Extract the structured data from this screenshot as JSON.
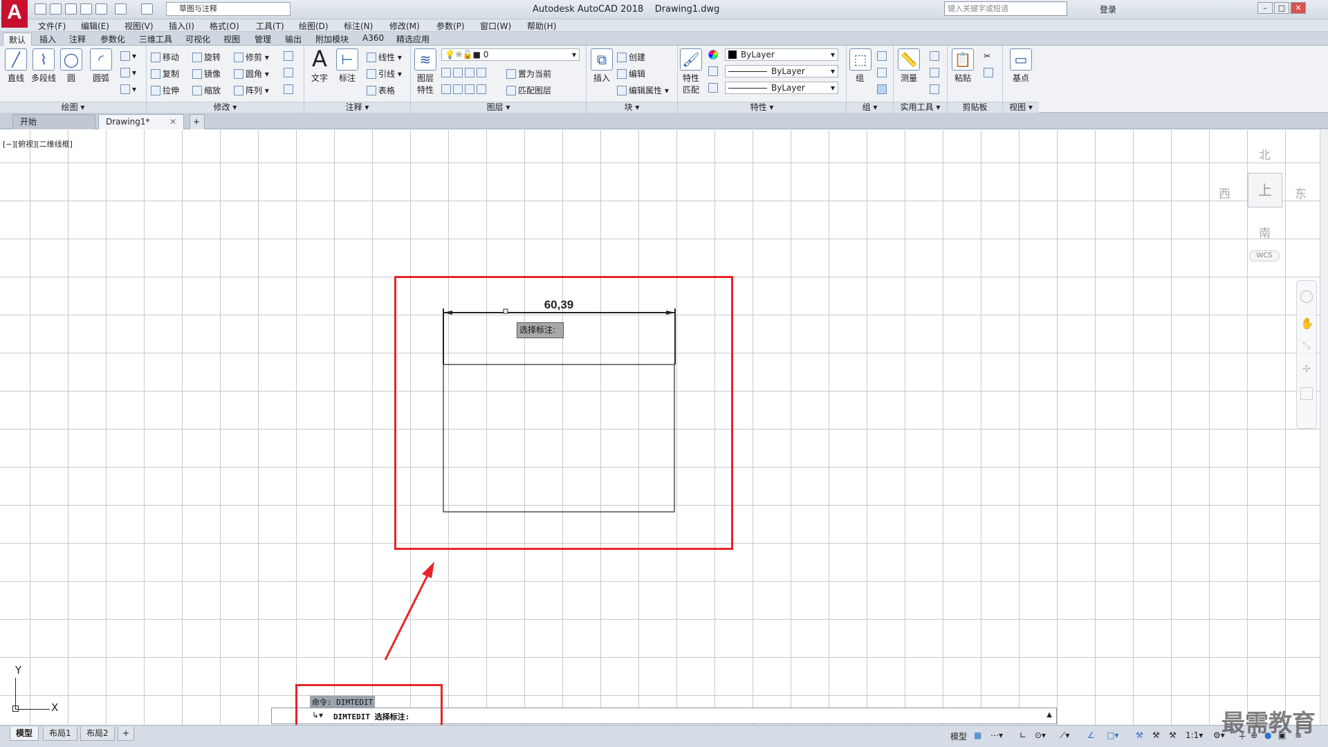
{
  "titlebar": {
    "workspace": "草图与注释",
    "title": "Autodesk AutoCAD 2018",
    "file": "Drawing1.dwg",
    "search_placeholder": "键入关键字或短语",
    "login": "登录"
  },
  "menu": [
    "文件(F)",
    "编辑(E)",
    "视图(V)",
    "插入(I)",
    "格式(O)",
    "工具(T)",
    "绘图(D)",
    "标注(N)",
    "修改(M)",
    "参数(P)",
    "窗口(W)",
    "帮助(H)"
  ],
  "ribbon_tabs": [
    "默认",
    "插入",
    "注释",
    "参数化",
    "三维工具",
    "可视化",
    "视图",
    "管理",
    "输出",
    "附加模块",
    "A360",
    "精选应用"
  ],
  "panels": {
    "draw": {
      "title": "绘图",
      "line": "直线",
      "polyline": "多段线",
      "circle": "圆",
      "arc": "圆弧"
    },
    "modify": {
      "title": "修改",
      "move": "移动",
      "rotate": "旋转",
      "trim": "修剪",
      "copy": "复制",
      "mirror": "镜像",
      "fillet": "圆角",
      "stretch": "拉伸",
      "scale": "缩放",
      "array": "阵列"
    },
    "annotation": {
      "title": "注释",
      "text": "文字",
      "dimension": "标注",
      "linear": "线性",
      "leader": "引线",
      "table": "表格"
    },
    "layers": {
      "title": "图层",
      "layer_props": "图层特性",
      "current_layer": "0",
      "set_current": "置为当前",
      "match": "匹配图层"
    },
    "block": {
      "title": "块",
      "insert": "插入",
      "create": "创建",
      "edit": "编辑",
      "edit_attr": "编辑属性"
    },
    "properties": {
      "title": "特性",
      "match": "特性匹配",
      "color": "ByLayer",
      "linetype": "ByLayer",
      "lineweight": "ByLayer"
    },
    "groups": {
      "title": "组",
      "group": "组"
    },
    "utilities": {
      "title": "实用工具",
      "measure": "测量"
    },
    "clipboard": {
      "title": "剪贴板",
      "paste": "粘贴"
    },
    "view": {
      "title": "视图",
      "base": "基点"
    }
  },
  "file_tabs": {
    "start": "开始",
    "drawing": "Drawing1*"
  },
  "viewport_label": "[−][俯视][二维线框]",
  "viewcube": {
    "north": "北",
    "south": "南",
    "east": "东",
    "west": "西",
    "wcs": "WCS",
    "face": "上"
  },
  "drawing": {
    "dimension_value": "60,39",
    "tooltip": "选择标注:"
  },
  "command": {
    "history": "命令: DIMTEDIT",
    "current": "DIMTEDIT 选择标注:"
  },
  "layout_tabs": [
    "模型",
    "布局1",
    "布局2"
  ],
  "status": {
    "model": "模型",
    "scale": "1:1"
  },
  "watermark": "最需教育",
  "ucs": {
    "x": "X",
    "y": "Y"
  }
}
